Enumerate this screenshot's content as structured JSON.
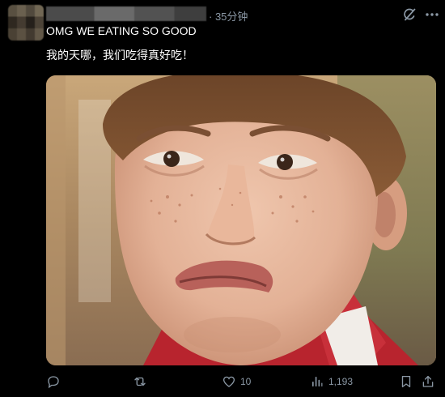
{
  "post": {
    "time": "· 35分钟",
    "text_line1": "OMG WE EATING SO GOOD",
    "text_line2": "我的天哪，我们吃得真好吃！",
    "image_alt": "boy grimacing with a disgusted face"
  },
  "actions": {
    "reply_count": "",
    "repost_count": "",
    "like_count": "10",
    "views_count": "1,193"
  },
  "icons": [
    "grok-icon",
    "more-icon",
    "reply-icon",
    "repost-icon",
    "like-icon",
    "views-icon",
    "bookmark-icon",
    "share-icon"
  ],
  "colors": {
    "background": "#000000",
    "text": "#ffffff",
    "muted": "#8b98a5"
  }
}
